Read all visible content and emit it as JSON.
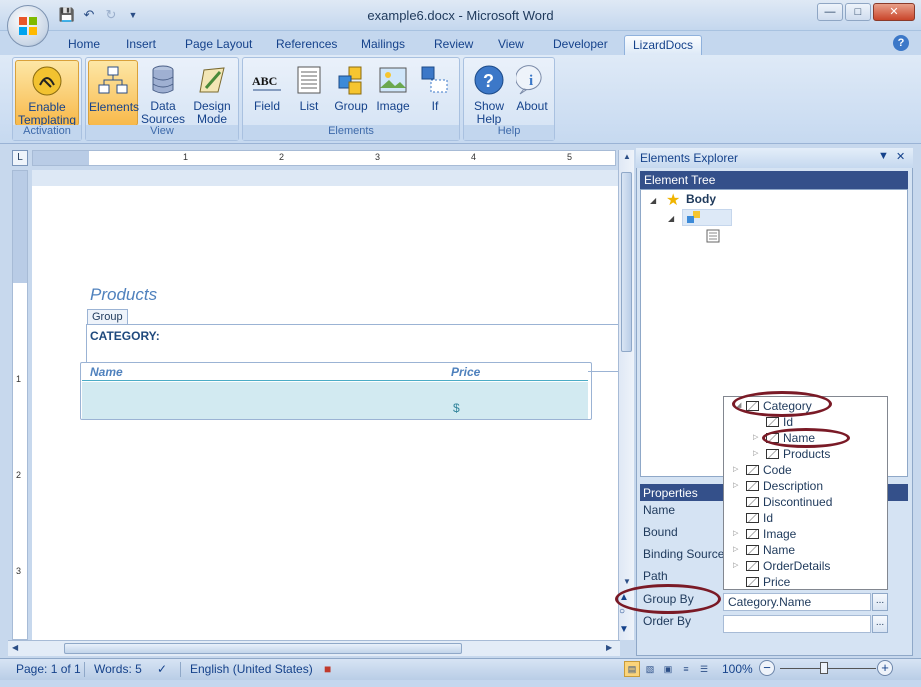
{
  "window": {
    "title": "example6.docx - Microsoft Word"
  },
  "tabs": [
    "Home",
    "Insert",
    "Page Layout",
    "References",
    "Mailings",
    "Review",
    "View",
    "Developer",
    "LizardDocs"
  ],
  "ribbon": {
    "groups": {
      "activation": "Activation",
      "view": "View",
      "elements": "Elements",
      "help": "Help"
    },
    "buttons": {
      "enable_templating": "Enable Templating",
      "elements": "Elements",
      "data_sources": "Data Sources",
      "design_mode": "Design Mode",
      "field": "Field",
      "list": "List",
      "group": "Group",
      "image": "Image",
      "if": "If",
      "show_help": "Show Help",
      "about": "About"
    }
  },
  "ruler": {
    "h_numbers": [
      "1",
      "2",
      "3",
      "4",
      "5"
    ],
    "v_numbers": [
      "1",
      "2",
      "3"
    ]
  },
  "document": {
    "title": "Products",
    "group_tag": "Group",
    "category_label": "CATEGORY:",
    "col_name": "Name",
    "col_price": "Price",
    "price_symbol": "$"
  },
  "explorer": {
    "title": "Elements Explorer",
    "tree_title": "Element Tree",
    "root": "Body",
    "properties_title": "Properties",
    "properties": {
      "name": "Name",
      "bound": "Bound",
      "binding_source": "Binding Source",
      "path": "Path",
      "group_by": "Group By",
      "order_by": "Order By",
      "group_by_value": "Category.Name",
      "order_by_value": ""
    },
    "dropdown": [
      "Category",
      "Id",
      "Name",
      "Products",
      "Code",
      "Description",
      "Discontinued",
      "Id",
      "Image",
      "Name",
      "OrderDetails",
      "Price"
    ]
  },
  "status": {
    "page": "Page: 1 of 1",
    "words": "Words: 5",
    "language": "English (United States)",
    "zoom": "100%"
  },
  "colors": {
    "accent": "#4f81bd",
    "oval": "#7a1a26",
    "pane_header": "#34508a"
  }
}
